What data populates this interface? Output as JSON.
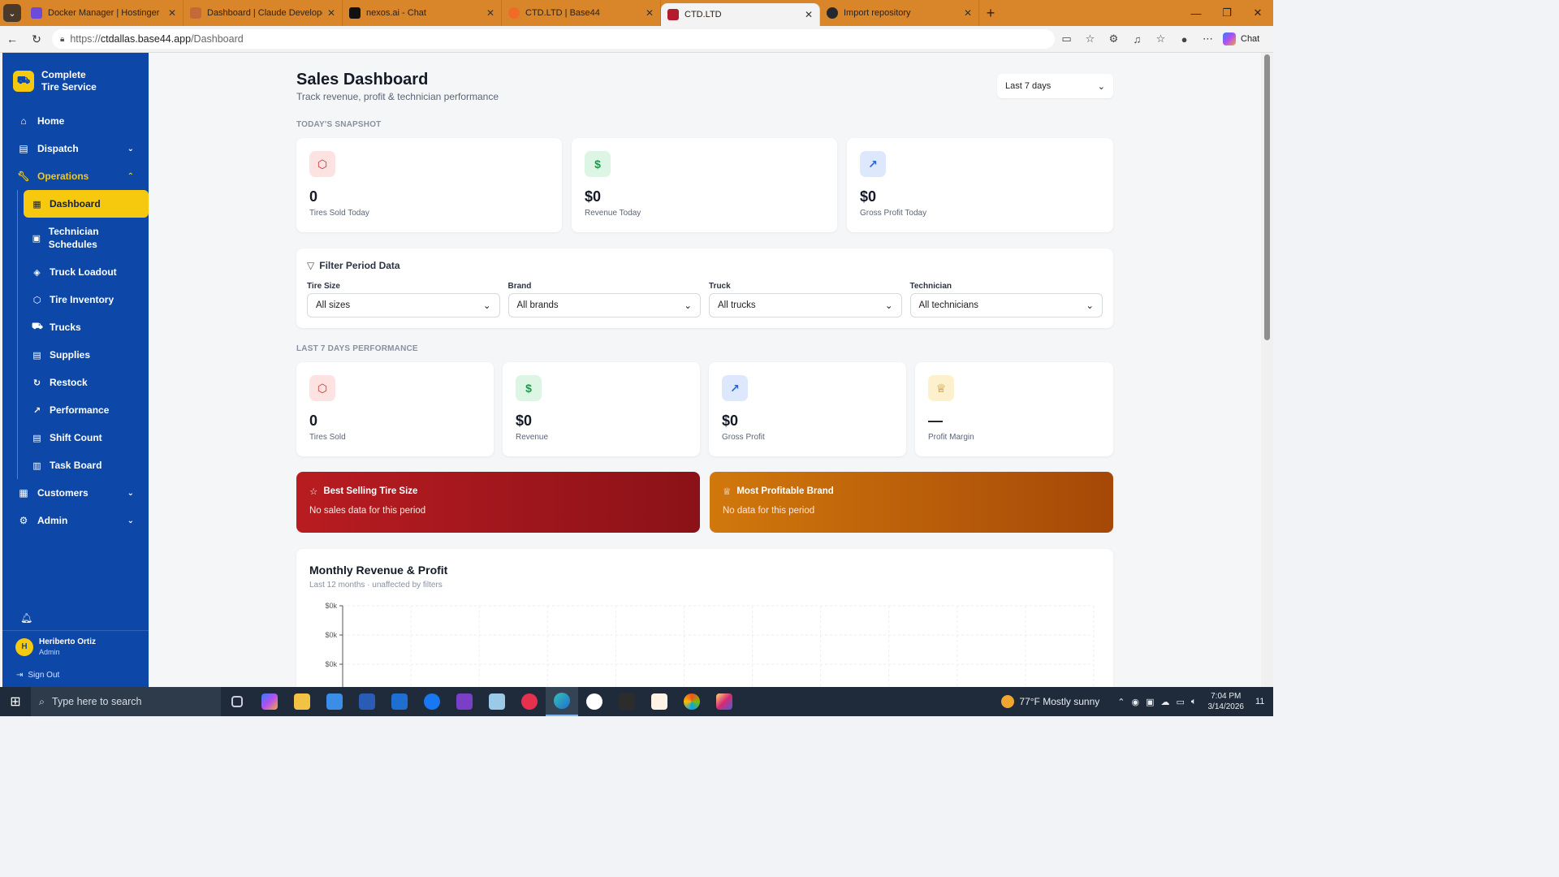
{
  "browser": {
    "tabs": [
      {
        "label": "Docker Manager | Hostinger",
        "color": "#6b4bd8"
      },
      {
        "label": "Dashboard | Claude Developer Pla",
        "color": "#c46a3a"
      },
      {
        "label": "nexos.ai - Chat",
        "color": "#111111"
      },
      {
        "label": "CTD.LTD | Base44",
        "color": "#f06a28"
      },
      {
        "label": "CTD.LTD",
        "color": "#b31c2c"
      },
      {
        "label": "Import repository",
        "color": "#24292f"
      }
    ],
    "active_tab": 4,
    "url_prefix": "https://",
    "url_host": "ctdallas.base44.app",
    "url_path": "/Dashboard",
    "chat_label": "Chat"
  },
  "sidebar": {
    "brand_line1": "Complete",
    "brand_line2": "Tire Service",
    "items": {
      "home": "Home",
      "dispatch": "Dispatch",
      "operations": "Operations",
      "customers": "Customers",
      "admin": "Admin"
    },
    "operations_sub": {
      "dashboard": "Dashboard",
      "technician_schedules": "Technician Schedules",
      "truck_loadout": "Truck Loadout",
      "tire_inventory": "Tire Inventory",
      "trucks": "Trucks",
      "supplies": "Supplies",
      "restock": "Restock",
      "performance": "Performance",
      "shift_count": "Shift Count",
      "task_board": "Task Board"
    },
    "user": {
      "initial": "H",
      "name": "Heriberto Ortiz",
      "role": "Admin"
    },
    "sign_out": "Sign Out"
  },
  "dashboard": {
    "title": "Sales Dashboard",
    "subtitle": "Track revenue, profit & technician performance",
    "period": "Last 7 days",
    "snapshot_label": "TODAY'S SNAPSHOT",
    "snapshot": [
      {
        "value": "0",
        "label": "Tires Sold Today"
      },
      {
        "value": "$0",
        "label": "Revenue Today"
      },
      {
        "value": "$0",
        "label": "Gross Profit Today"
      }
    ],
    "filter": {
      "title": "Filter Period Data",
      "fields": [
        {
          "label": "Tire Size",
          "value": "All sizes"
        },
        {
          "label": "Brand",
          "value": "All brands"
        },
        {
          "label": "Truck",
          "value": "All trucks"
        },
        {
          "label": "Technician",
          "value": "All technicians"
        }
      ]
    },
    "performance_label": "LAST 7 DAYS PERFORMANCE",
    "performance": [
      {
        "value": "0",
        "label": "Tires Sold"
      },
      {
        "value": "$0",
        "label": "Revenue"
      },
      {
        "value": "$0",
        "label": "Gross Profit"
      },
      {
        "value": "—",
        "label": "Profit Margin"
      }
    ],
    "best_selling": {
      "title": "Best Selling Tire Size",
      "text": "No sales data for this period"
    },
    "most_profitable": {
      "title": "Most Profitable Brand",
      "text": "No data for this period"
    },
    "chart": {
      "title": "Monthly Revenue & Profit",
      "subtitle": "Last 12 months · unaffected by filters"
    }
  },
  "chart_data": {
    "type": "bar",
    "title": "Monthly Revenue & Profit",
    "subtitle": "Last 12 months · unaffected by filters",
    "ytick_labels": [
      "$0k",
      "$0k",
      "$0k"
    ],
    "values": [],
    "grid": true
  },
  "taskbar": {
    "search_placeholder": "Type here to search",
    "weather": "77°F  Mostly sunny",
    "time": "7:04 PM",
    "date": "3/14/2026",
    "notif_count": "11"
  }
}
